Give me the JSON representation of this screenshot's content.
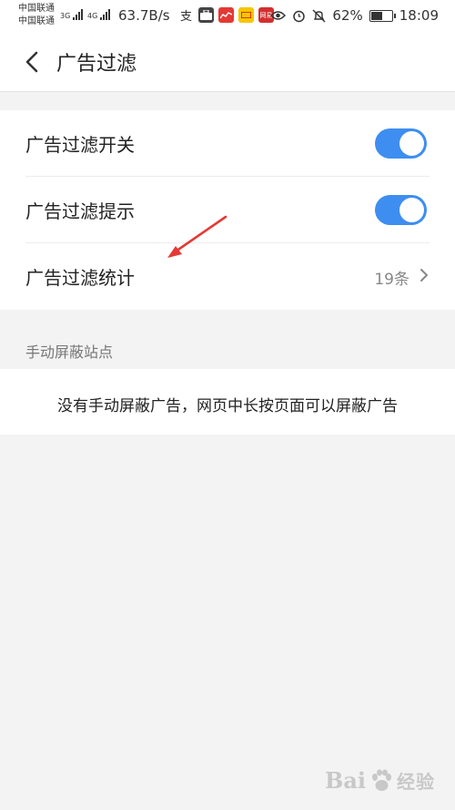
{
  "status_bar": {
    "carrier1": "中国联通",
    "carrier2": "中国联通",
    "net1": "3G",
    "net2": "4G",
    "speed": "63.7B/s",
    "app_icon_labels": [
      "支",
      "",
      "",
      "网易"
    ],
    "battery_percent_text": "62%",
    "battery_level": 0.62,
    "time": "18:09"
  },
  "header": {
    "title": "广告过滤"
  },
  "settings": {
    "row1_label": "广告过滤开关",
    "row1_on": true,
    "row2_label": "广告过滤提示",
    "row2_on": true,
    "row3_label": "广告过滤统计",
    "row3_value": "19条"
  },
  "manual_block": {
    "section_title": "手动屏蔽站点",
    "empty_text": "没有手动屏蔽广告，网页中长按页面可以屏蔽广告"
  },
  "watermark": {
    "text": "Bai",
    "text2": "经验"
  },
  "colors": {
    "accent": "#3d8ef0",
    "annotation_arrow": "#e53935"
  }
}
